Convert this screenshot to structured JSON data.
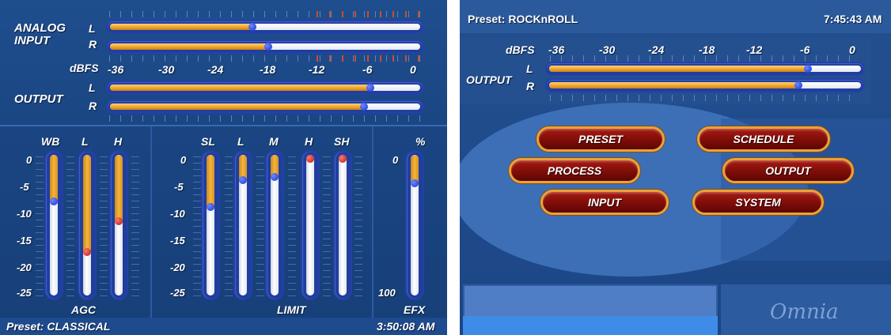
{
  "left": {
    "input": {
      "label_line1": "ANALOG",
      "label_line2": "INPUT",
      "channels": [
        {
          "label": "L",
          "level": 0.46
        },
        {
          "label": "R",
          "level": 0.51
        }
      ]
    },
    "scale": {
      "unit": "dBFS",
      "ticks": [
        "-36",
        "-30",
        "-24",
        "-18",
        "-12",
        "-6",
        "0"
      ]
    },
    "output": {
      "label": "OUTPUT",
      "channels": [
        {
          "label": "L",
          "level": 0.84
        },
        {
          "label": "R",
          "level": 0.82
        }
      ]
    },
    "agc": {
      "label": "AGC",
      "scale": [
        "0",
        "-5",
        "-10",
        "-15",
        "-20",
        "-25"
      ],
      "bars": [
        {
          "label": "WB",
          "level": 0.33,
          "knob": "blue"
        },
        {
          "label": "L",
          "level": 0.69,
          "knob": "red"
        },
        {
          "label": "H",
          "level": 0.47,
          "knob": "red"
        }
      ]
    },
    "limit": {
      "label": "LIMIT",
      "scale": [
        "0",
        "-5",
        "-10",
        "-15",
        "-20",
        "-25"
      ],
      "bars": [
        {
          "label": "SL",
          "level": 0.37,
          "knob": "blue"
        },
        {
          "label": "L",
          "level": 0.18,
          "knob": "blue"
        },
        {
          "label": "M",
          "level": 0.16,
          "knob": "blue"
        },
        {
          "label": "H",
          "level": 0.02,
          "knob": "red"
        },
        {
          "label": "SH",
          "level": 0.02,
          "knob": "red"
        }
      ]
    },
    "efx": {
      "label": "EFX",
      "unit": "%",
      "top": "0",
      "bottom": "100",
      "level": 0.2
    },
    "status": {
      "preset": "Preset: CLASSICAL",
      "time": "3:50:08 AM"
    }
  },
  "right": {
    "header": {
      "preset": "Preset: ROCKnROLL",
      "time": "7:45:43 AM"
    },
    "scale": {
      "unit": "dBFS",
      "ticks": [
        "-36",
        "-30",
        "-24",
        "-18",
        "-12",
        "-6",
        "0"
      ]
    },
    "output": {
      "label": "OUTPUT",
      "channels": [
        {
          "label": "L",
          "level": 0.83
        },
        {
          "label": "R",
          "level": 0.8
        }
      ]
    },
    "menu": {
      "preset": "PRESET",
      "schedule": "SCHEDULE",
      "process": "PROCESS",
      "output": "OUTPUT",
      "input": "INPUT",
      "system": "SYSTEM"
    },
    "logo": "Omnia"
  },
  "colors": {
    "panel_bg": "#1f4e8e",
    "meter_fill": "#f0a52a",
    "knob_blue": "#1a2fd0",
    "knob_red": "#b81210",
    "button_border": "#e8a33a",
    "button_fill": "#7a0c08"
  }
}
